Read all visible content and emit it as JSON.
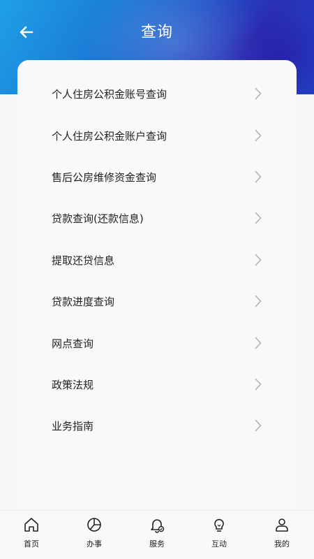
{
  "header": {
    "title": "查询",
    "back_icon": "arrow-left-icon"
  },
  "menu": {
    "items": [
      {
        "label": "个人住房公积金账号查询"
      },
      {
        "label": "个人住房公积金账户查询"
      },
      {
        "label": "售后公房维修资金查询"
      },
      {
        "label": "贷款查询(还款信息)"
      },
      {
        "label": "提取还贷信息"
      },
      {
        "label": "贷款进度查询"
      },
      {
        "label": "网点查询"
      },
      {
        "label": "政策法规"
      },
      {
        "label": "业务指南"
      }
    ],
    "chevron_icon": "chevron-right-icon"
  },
  "tabbar": {
    "tabs": [
      {
        "label": "首页",
        "icon": "home-icon"
      },
      {
        "label": "办事",
        "icon": "pie-chart-icon"
      },
      {
        "label": "服务",
        "icon": "bell-check-icon"
      },
      {
        "label": "互动",
        "icon": "lightbulb-icon"
      },
      {
        "label": "我的",
        "icon": "user-icon"
      }
    ]
  },
  "colors": {
    "header_gradient_start": "#1fa0e6",
    "header_gradient_end": "#2a2fb5",
    "background": "#f7f7f8",
    "text": "#222222",
    "chevron": "#b3b3b3"
  }
}
